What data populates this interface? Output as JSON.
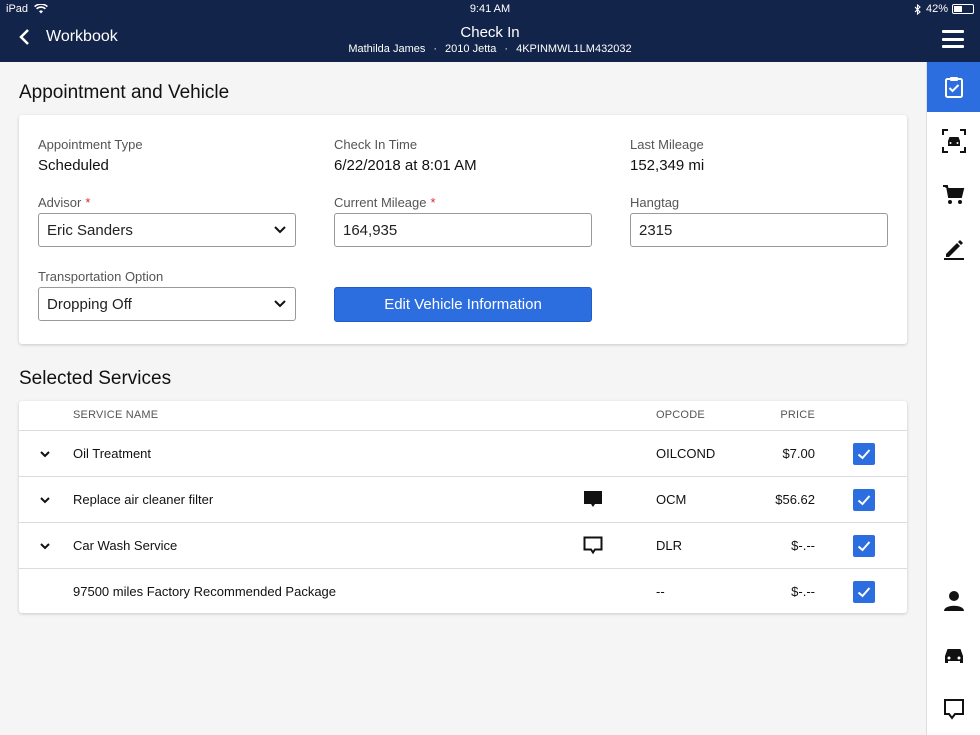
{
  "status_bar": {
    "device": "iPad",
    "time": "9:41 AM",
    "battery": "42%",
    "battery_level": 0.42
  },
  "header": {
    "back_label": "Workbook",
    "title": "Check In",
    "customer": "Mathilda James",
    "vehicle": "2010 Jetta",
    "vin": "4KPINMWL1LM432032",
    "separator": "·"
  },
  "appointment": {
    "section_title": "Appointment and Vehicle",
    "appointment_type_label": "Appointment Type",
    "appointment_type_value": "Scheduled",
    "check_in_time_label": "Check In Time",
    "check_in_time_value": "6/22/2018 at 8:01 AM",
    "last_mileage_label": "Last Mileage",
    "last_mileage_value": "152,349 mi",
    "advisor_label": "Advisor",
    "advisor_value": "Eric Sanders",
    "current_mileage_label": "Current Mileage",
    "current_mileage_value": "164,935",
    "hangtag_label": "Hangtag",
    "hangtag_value": "2315",
    "transportation_label": "Transportation Option",
    "transportation_value": "Dropping Off",
    "required_mark": "*",
    "edit_button": "Edit Vehicle Information"
  },
  "services": {
    "section_title": "Selected Services",
    "columns": {
      "name": "SERVICE NAME",
      "opcode": "OPCODE",
      "price": "PRICE"
    },
    "rows": [
      {
        "name": "Oil Treatment",
        "opcode": "OILCOND",
        "price": "$7.00",
        "checked": true,
        "expandable": true,
        "note": "none"
      },
      {
        "name": "Replace air cleaner filter",
        "opcode": "OCM",
        "price": "$56.62",
        "checked": true,
        "expandable": true,
        "note": "filled"
      },
      {
        "name": "Car Wash Service",
        "opcode": "DLR",
        "price": "$-.--",
        "checked": true,
        "expandable": true,
        "note": "outline"
      },
      {
        "name": "97500 miles Factory Recommended Package",
        "opcode": "--",
        "price": "$-.--",
        "checked": true,
        "expandable": false,
        "note": "none"
      }
    ]
  },
  "sidebar": {
    "items": [
      {
        "icon": "clipboard-check-icon",
        "active": true
      },
      {
        "icon": "vehicle-scan-icon",
        "active": false
      },
      {
        "icon": "cart-icon",
        "active": false
      },
      {
        "icon": "edit-pencil-icon",
        "active": false
      },
      {
        "icon": "person-icon",
        "active": false
      },
      {
        "icon": "car-icon",
        "active": false
      },
      {
        "icon": "comment-icon",
        "active": false
      }
    ]
  },
  "colors": {
    "header_bg": "#13244a",
    "accent": "#2c6ee0",
    "required": "#d32f2f"
  }
}
